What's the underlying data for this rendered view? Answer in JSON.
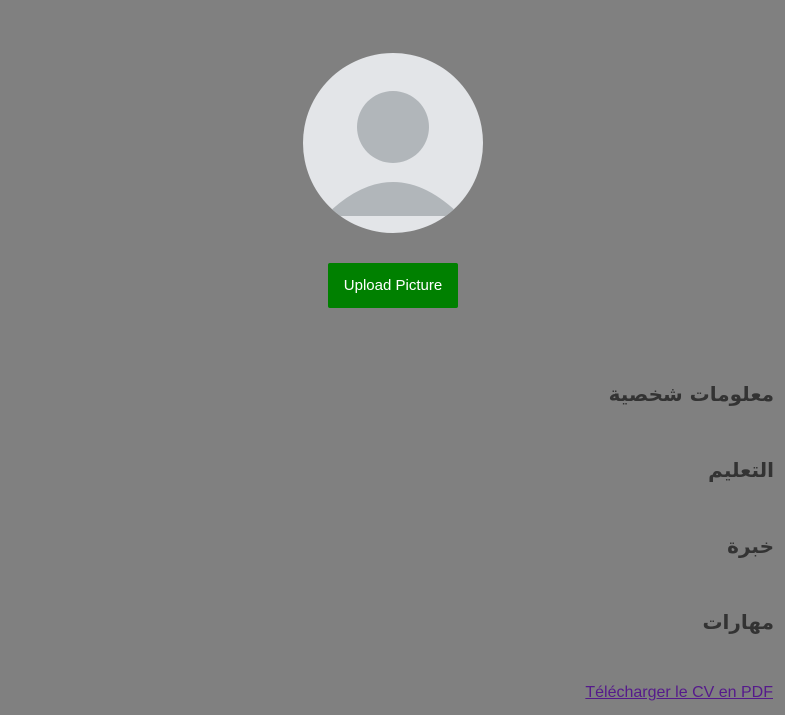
{
  "colors": {
    "background": "#808080",
    "avatar_background": "#e3e5e8",
    "avatar_figure": "#b1b6ba",
    "upload_button": "#008000",
    "heading_text": "#333333",
    "visited_link": "#551a8b"
  },
  "profile": {
    "avatar_icon": "default-user-silhouette-icon",
    "upload_label": "Upload Picture"
  },
  "sections": [
    {
      "title": "معلومات شخصية"
    },
    {
      "title": "التعليم"
    },
    {
      "title": "خبرة"
    },
    {
      "title": "مهارات"
    }
  ],
  "download": {
    "label": "Télécharger le CV en PDF"
  }
}
